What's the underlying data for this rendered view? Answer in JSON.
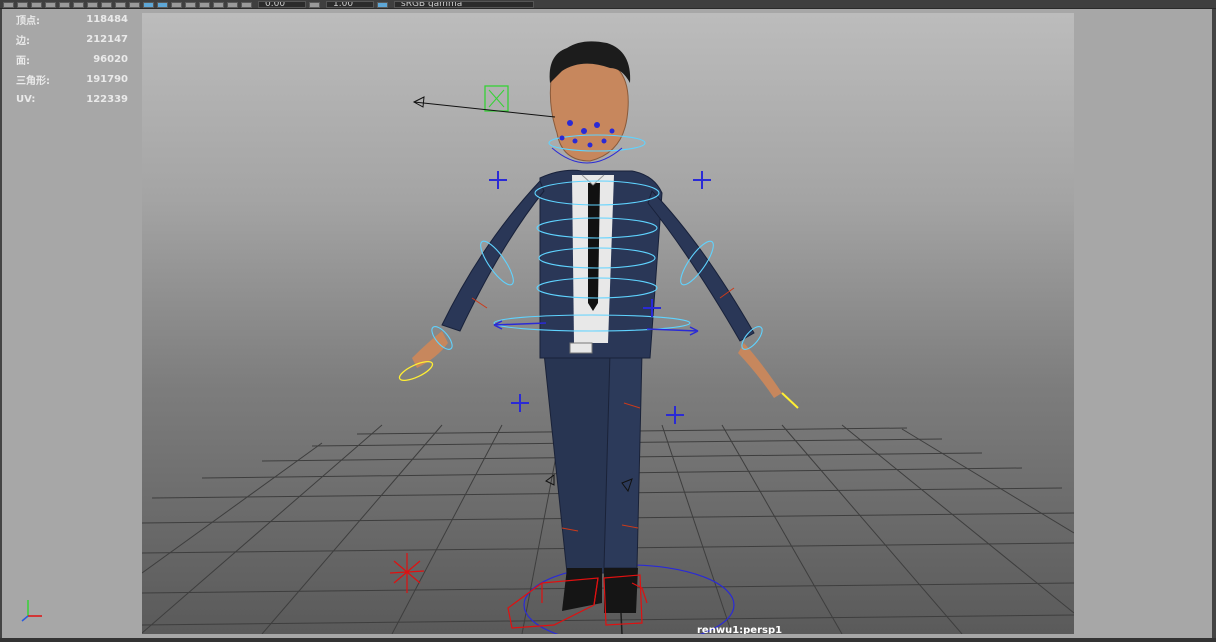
{
  "toolbar": {
    "colorspace_value": "sRGB gamma",
    "field_a_value": "0.00",
    "field_b_value": "1.00",
    "icons": [
      "select-icon",
      "move-icon",
      "grid-icon",
      "wireframe-icon",
      "shaded-icon",
      "texture-icon",
      "light-icon",
      "shadow-icon",
      "ao-icon",
      "aa-icon",
      "dof-icon",
      "isolate-icon",
      "xray-icon",
      "camera-icon",
      "film-gate-icon",
      "resolution-gate-icon",
      "safe-action-icon",
      "exposure-icon",
      "gamma-icon",
      "colorspace-icon"
    ]
  },
  "hud": {
    "rows": [
      {
        "label": "顶点:",
        "value": "118484",
        "selected": "0",
        "tri": "0"
      },
      {
        "label": "边:",
        "value": "212147",
        "selected": "0",
        "tri": "0"
      },
      {
        "label": "面:",
        "value": "96020",
        "selected": "0",
        "tri": "0"
      },
      {
        "label": "三角形:",
        "value": "191790",
        "selected": "0",
        "tri": "0"
      },
      {
        "label": "UV:",
        "value": "122339",
        "selected": "0",
        "tri": "0"
      }
    ]
  },
  "viewport": {
    "camera_label": "renwu1:persp1"
  },
  "colors": {
    "rig_cyan": "#5fd3ff",
    "rig_blue": "#2a2ad6",
    "rig_red": "#e01010",
    "rig_yellow": "#ffee33",
    "suit": "#283552",
    "skin": "#c7875d"
  }
}
